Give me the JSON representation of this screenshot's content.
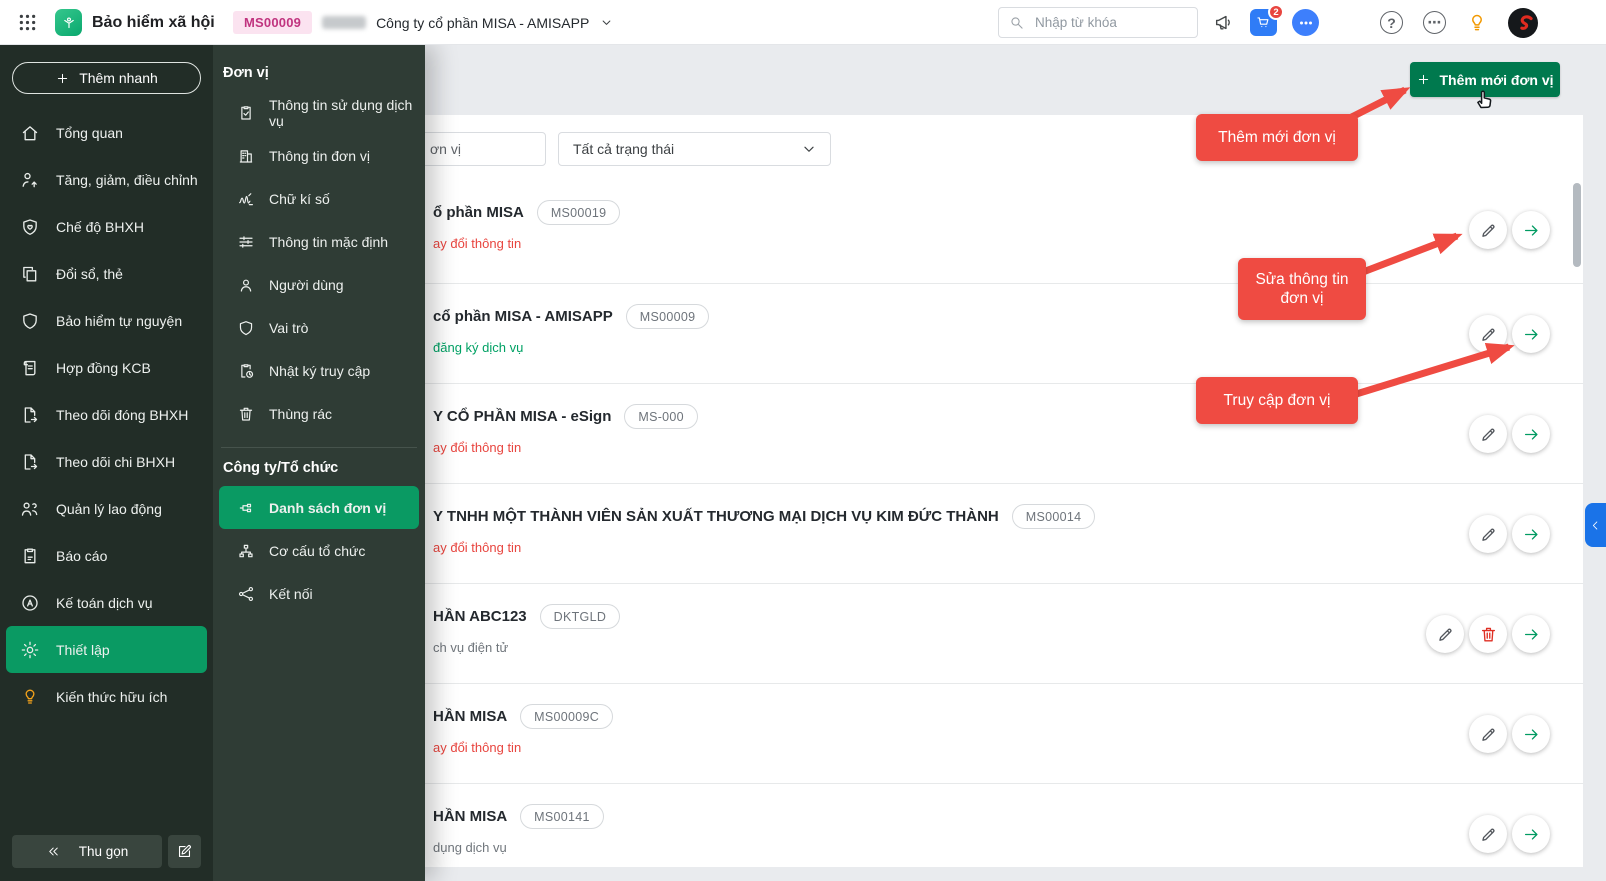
{
  "topbar": {
    "app_title": "Bảo hiểm xã hội",
    "unit_code_badge": "MS00009",
    "company_name": "Công ty cổ phần MISA - AMISAPP",
    "search_placeholder": "Nhập từ khóa",
    "cart_badge": "2",
    "help_glyph": "?",
    "more_glyph": "⋯"
  },
  "sidebar": {
    "quick_add": "Thêm nhanh",
    "collapse_label": "Thu gọn",
    "items": [
      {
        "name": "tong-quan",
        "label": "Tổng quan",
        "icon": "home-icon"
      },
      {
        "name": "tang-giam-dieu-chinh",
        "label": "Tăng, giảm, điều chỉnh",
        "icon": "user-adjust-icon"
      },
      {
        "name": "che-do-bhxh",
        "label": "Chế độ BHXH",
        "icon": "shield-heart-icon"
      },
      {
        "name": "doi-so-the",
        "label": "Đổi sổ, thẻ",
        "icon": "copy-icon"
      },
      {
        "name": "bao-hiem-tu-nguyen",
        "label": "Bảo hiểm tự nguyện",
        "icon": "shield-icon"
      },
      {
        "name": "hop-dong-kcb",
        "label": "Hợp đồng KCB",
        "icon": "contract-icon"
      },
      {
        "name": "theo-doi-dong-bhxh",
        "label": "Theo dõi đóng BHXH",
        "icon": "doc-export-icon"
      },
      {
        "name": "theo-doi-chi-bhxh",
        "label": "Theo dõi chi BHXH",
        "icon": "doc-export-icon"
      },
      {
        "name": "quan-ly-lao-dong",
        "label": "Quản lý lao động",
        "icon": "users-icon"
      },
      {
        "name": "bao-cao",
        "label": "Báo cáo",
        "icon": "report-icon"
      },
      {
        "name": "ke-toan-dich-vu",
        "label": "Kế toán dịch vụ",
        "icon": "accounting-icon"
      },
      {
        "name": "thiet-lap",
        "label": "Thiết lập",
        "icon": "gear-icon",
        "active": true
      },
      {
        "name": "kien-thuc-huu-ich",
        "label": "Kiến thức hữu ích",
        "icon": "knowledge-icon",
        "orange": true
      }
    ]
  },
  "flyout": {
    "sections": [
      {
        "title": "Đơn vị",
        "items": [
          {
            "name": "thong-tin-su-dung-dich-vu",
            "label": "Thông tin sử dụng dịch vụ",
            "icon": "clipboard-check-icon"
          },
          {
            "name": "thong-tin-don-vi",
            "label": "Thông tin đơn vị",
            "icon": "building-icon"
          },
          {
            "name": "chu-ki-so",
            "label": "Chữ kí số",
            "icon": "signature-icon"
          },
          {
            "name": "thong-tin-mac-dinh",
            "label": "Thông tin mặc định",
            "icon": "sliders-icon"
          },
          {
            "name": "nguoi-dung",
            "label": "Người dùng",
            "icon": "user-icon"
          },
          {
            "name": "vai-tro",
            "label": "Vai trò",
            "icon": "shield-icon"
          },
          {
            "name": "nhat-ky-truy-cap",
            "label": "Nhật ký truy cập",
            "icon": "clipboard-clock-icon"
          },
          {
            "name": "thung-rac",
            "label": "Thùng rác",
            "icon": "trash-icon"
          }
        ]
      },
      {
        "title": "Công ty/Tổ chức",
        "items": [
          {
            "name": "danh-sach-don-vi",
            "label": "Danh sách đơn vị",
            "icon": "unit-list-icon",
            "active": true
          },
          {
            "name": "co-cau-to-chuc",
            "label": "Cơ cấu tổ chức",
            "icon": "org-structure-icon"
          },
          {
            "name": "ket-noi",
            "label": "Kết nối",
            "icon": "connect-icon"
          }
        ]
      }
    ]
  },
  "main": {
    "add_button": "Thêm mới đơn vị",
    "search_visible_text": "ơn vị",
    "status_filter_value": "Tất cả trạng thái",
    "rows": [
      {
        "title": "ổ phần MISA",
        "code": "MS00019",
        "status": "ay đổi thông tin",
        "status_color": "red",
        "actions": [
          "edit",
          "open"
        ]
      },
      {
        "title": "cổ phần MISA - AMISAPP",
        "code": "MS00009",
        "status": "đăng ký dịch vụ",
        "status_color": "green",
        "actions": [
          "edit",
          "open"
        ]
      },
      {
        "title": "Y CỔ PHẦN MISA - eSign",
        "code": "MS-000",
        "status": "ay đổi thông tin",
        "status_color": "red",
        "actions": [
          "edit",
          "open"
        ]
      },
      {
        "title": "Y TNHH MỘT THÀNH VIÊN SẢN XUẤT THƯƠNG MẠI DỊCH VỤ KIM ĐỨC THÀNH",
        "code": "MS00014",
        "status": "ay đổi thông tin",
        "status_color": "red",
        "actions": [
          "edit",
          "open"
        ]
      },
      {
        "title": "HẦN ABC123",
        "code": "DKTGLD",
        "status": "ch vụ điện tử",
        "status_color": "grey",
        "actions": [
          "edit",
          "delete",
          "open"
        ]
      },
      {
        "title": "HẦN MISA",
        "code": "MS00009C",
        "status": "ay đổi thông tin",
        "status_color": "red",
        "actions": [
          "edit",
          "open"
        ]
      },
      {
        "title": "HẦN MISA",
        "code": "MS00141",
        "status": "dụng dịch vụ",
        "status_color": "grey",
        "actions": [
          "edit",
          "open"
        ]
      }
    ]
  },
  "callouts": [
    {
      "text": "Thêm mới đơn vị"
    },
    {
      "text": "Sửa thông tin đơn vị"
    },
    {
      "text": "Truy cập đơn vị"
    }
  ],
  "colors": {
    "accent_green": "#0A9A63",
    "button_green": "#00794E",
    "callout_red": "#EF4B42",
    "status_red": "#E8453F",
    "status_green": "#00A164",
    "status_grey": "#70767C",
    "badge_pink_bg": "#FBE3F0",
    "badge_pink_text": "#C0347F",
    "side_tab_blue": "#1A73E8"
  }
}
